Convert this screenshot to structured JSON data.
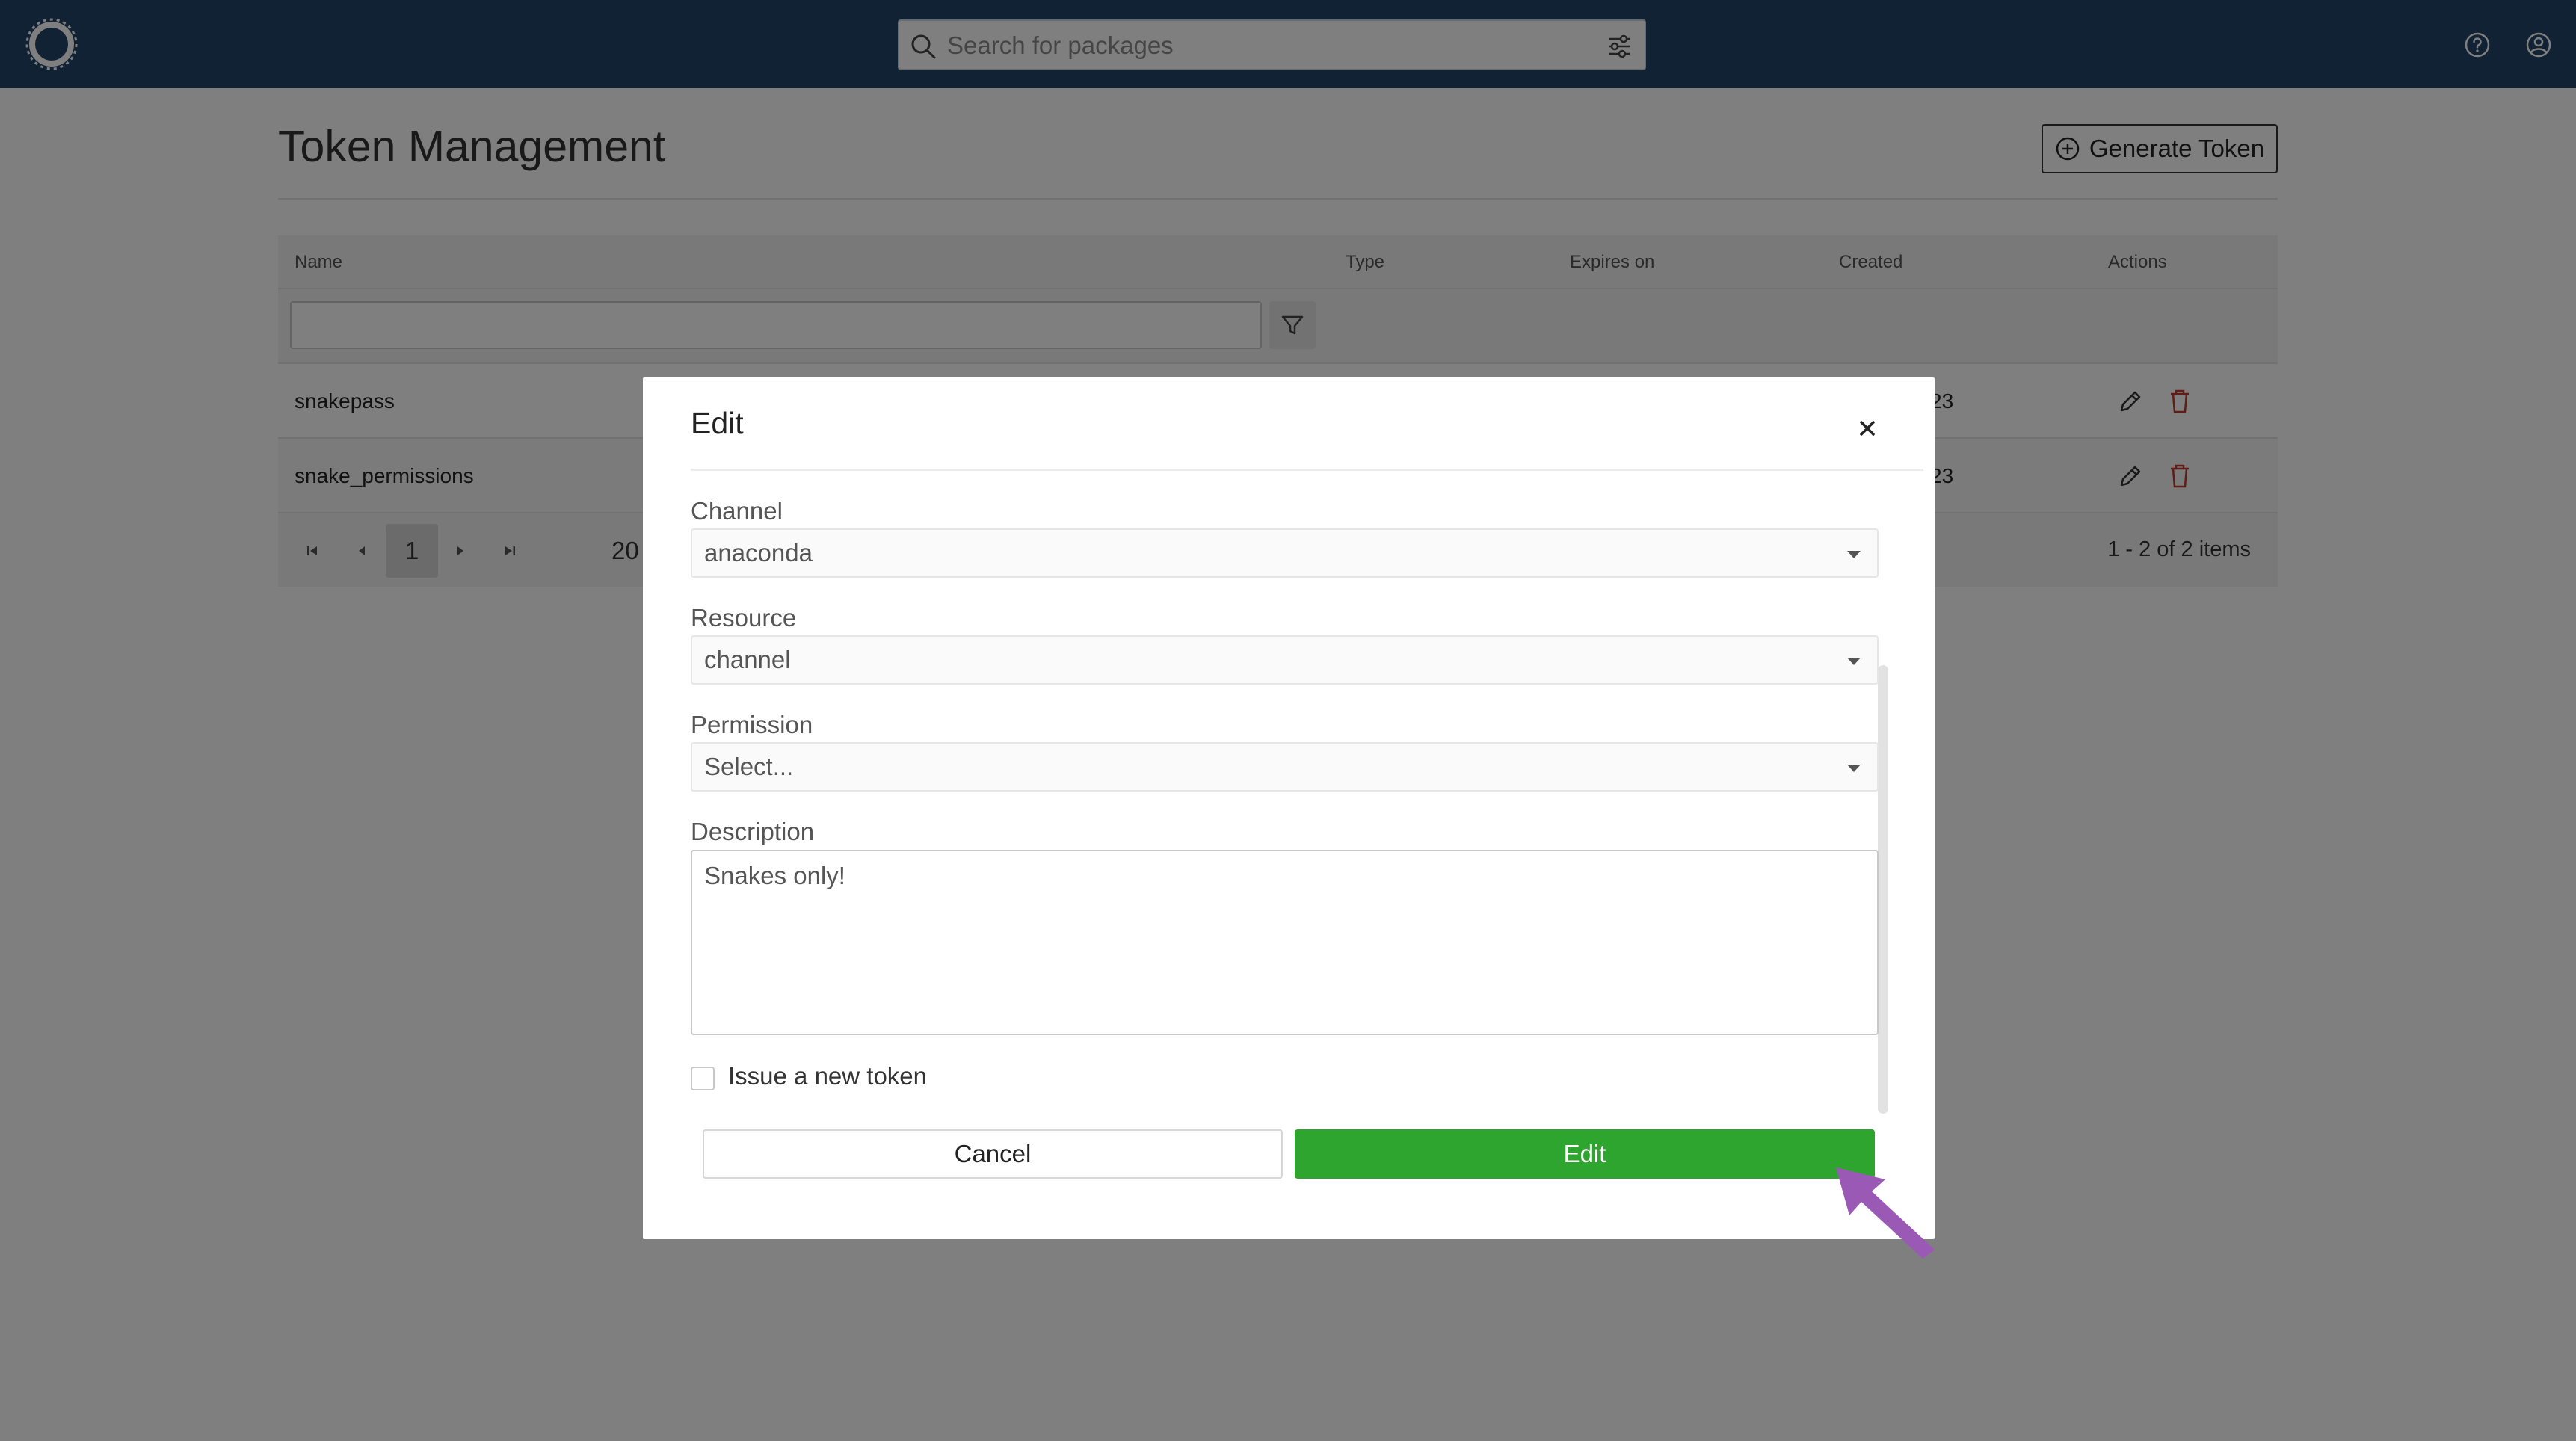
{
  "topbar": {
    "search_placeholder": "Search for packages",
    "icons": [
      "logo-icon",
      "search-icon",
      "filter-sliders-icon",
      "help-icon",
      "user-icon"
    ]
  },
  "page": {
    "title": "Token Management",
    "generate_label": "Generate Token"
  },
  "table": {
    "columns": [
      "Name",
      "Type",
      "Expires on",
      "Created",
      "Actions"
    ],
    "rows": [
      {
        "name": "snakepass",
        "created": "23"
      },
      {
        "name": "snake_permissions",
        "created": "23"
      }
    ],
    "pager": {
      "current_page": "1",
      "page_size": "20",
      "info": "1 - 2 of 2 items"
    }
  },
  "modal": {
    "title": "Edit",
    "fields": {
      "channel_label": "Channel",
      "channel_value": "anaconda",
      "resource_label": "Resource",
      "resource_value": "channel",
      "permission_label": "Permission",
      "permission_value": "Select...",
      "description_label": "Description",
      "description_value": "Snakes only!"
    },
    "checkbox_label": "Issue a new token",
    "cancel_label": "Cancel",
    "edit_label": "Edit"
  },
  "colors": {
    "topbar": "#22456b",
    "primary_button": "#2ea52e",
    "delete_icon": "#c0392b",
    "cursor": "#9b59b6"
  }
}
